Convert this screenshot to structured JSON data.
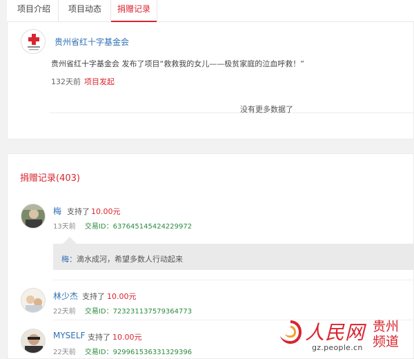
{
  "tabs": [
    {
      "label": "项目介绍",
      "active": false
    },
    {
      "label": "项目动态",
      "active": false
    },
    {
      "label": "捐赠记录",
      "active": true
    }
  ],
  "project_update": {
    "org_name": "贵州省红十字基金会",
    "post_text": "贵州省红十字基金会 发布了项目“救救我的女儿——极贫家庭的泣血呼救！”",
    "time": "132天前",
    "tag": "项目发起",
    "no_more": "没有更多数据了"
  },
  "records": {
    "title": "捐赠记录(403)",
    "items": [
      {
        "name": "梅",
        "action": "支持了",
        "amount": "10.00元",
        "time": "13天前",
        "tx_label": "交易ID：",
        "tx_id": "637645145424229972",
        "comment": "滴水成河，希望多数人行动起来"
      },
      {
        "name": "林少杰",
        "action": "支持了",
        "amount": "10.00元",
        "time": "22天前",
        "tx_label": "交易ID：",
        "tx_id": "723231137579364773"
      },
      {
        "name": "MYSELF",
        "action": "支持了",
        "amount": "10.00元",
        "time": "22天前",
        "tx_label": "交易ID：",
        "tx_id": "929961536331329396"
      }
    ],
    "comment_author": "梅："
  },
  "watermark": {
    "logo_text": "人民网",
    "region": "贵州频道",
    "url": "gz.people.cn"
  },
  "colors": {
    "accent": "#d8252f",
    "link": "#2f6fb3",
    "txid": "#2b8a3e"
  }
}
